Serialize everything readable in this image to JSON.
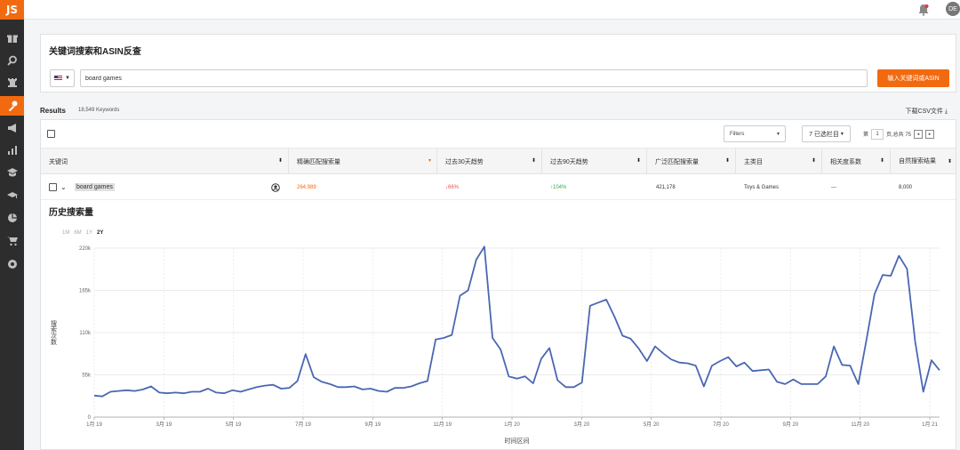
{
  "app": {
    "logo_text": "JS",
    "avatar_text": "DE"
  },
  "sidebar": {
    "items": [
      {
        "icon": "gift-icon"
      },
      {
        "icon": "search-icon"
      },
      {
        "icon": "chess-icon"
      },
      {
        "icon": "key-icon",
        "active": true
      },
      {
        "icon": "megaphone-icon"
      },
      {
        "icon": "bar-chart-icon"
      },
      {
        "icon": "academy-icon"
      },
      {
        "icon": "graduation-icon"
      },
      {
        "icon": "pie-icon"
      },
      {
        "icon": "cart-icon"
      },
      {
        "icon": "settings-icon"
      }
    ]
  },
  "search": {
    "title": "关键词搜索和ASIN反查",
    "country": "US",
    "query": "board games",
    "button_label": "输入关键词或ASIN"
  },
  "results": {
    "label": "Results",
    "count": "18,549 Keywords",
    "download_label": "下载CSV文件"
  },
  "toolbar": {
    "filters_label": "Filters",
    "selected_label": "7 已选栏目",
    "pager_prefix": "第",
    "page": "1",
    "pager_suffix": "页,总共 75"
  },
  "table": {
    "headers": [
      "关键词",
      "精确匹配搜索量",
      "过去30天趋势",
      "过去90天趋势",
      "广泛匹配搜索量",
      "主类目",
      "相关度系数",
      "自然搜索结果"
    ],
    "row": {
      "keyword": "board games",
      "exact_volume": "264,989",
      "trend_30": "66%",
      "trend_90": "104%",
      "broad_volume": "421,178",
      "category": "Toys & Games",
      "relevance": "---",
      "organic": "8,000"
    }
  },
  "chart_section": {
    "title": "历史搜索量",
    "ranges": [
      "1M",
      "6M",
      "1Y",
      "2Y"
    ],
    "active_range": "2Y"
  },
  "colors": {
    "accent": "#f26a10",
    "line": "#4a67b3",
    "down": "#e05555",
    "up": "#3aa657"
  },
  "chart_data": {
    "type": "line",
    "title": "",
    "xlabel": "时间区间",
    "ylabel": "搜索次数",
    "yticks": [
      "0",
      "55k",
      "110k",
      "165k",
      "220k"
    ],
    "ylim": [
      0,
      220000
    ],
    "xticks": [
      "1月 19",
      "3月 19",
      "5月 19",
      "7月 19",
      "9月 19",
      "11月 19",
      "1月 20",
      "3月 20",
      "5月 20",
      "7月 20",
      "9月 20",
      "11月 20",
      "1月 21"
    ],
    "grid": true,
    "series": [
      {
        "values": [
          28000,
          27000,
          33000,
          34000,
          35000,
          34000,
          36000,
          40000,
          32000,
          31000,
          32000,
          31000,
          33000,
          33000,
          37000,
          32000,
          31000,
          35000,
          33000,
          36000,
          39000,
          41000,
          42000,
          37000,
          38000,
          47000,
          82000,
          52000,
          46000,
          43000,
          39000,
          39000,
          40000,
          36000,
          37000,
          34000,
          33000,
          38000,
          38000,
          40000,
          44000,
          47000,
          101000,
          103000,
          107000,
          158000,
          165000,
          205000,
          222000,
          103000,
          88000,
          53000,
          50000,
          53000,
          44000,
          76000,
          90000,
          48000,
          39000,
          39000,
          45000,
          145000,
          149000,
          153000,
          131000,
          106000,
          102000,
          89000,
          73000,
          92000,
          83000,
          75000,
          71000,
          70000,
          67000,
          40000,
          67000,
          73000,
          78000,
          66000,
          71000,
          60000,
          61000,
          62000,
          46000,
          43000,
          49000,
          43000,
          43000,
          43000,
          53000,
          92000,
          68000,
          67000,
          43000,
          100000,
          160000,
          185000,
          184000,
          210000,
          193000,
          98000,
          33000,
          74000,
          61000
        ]
      }
    ]
  }
}
